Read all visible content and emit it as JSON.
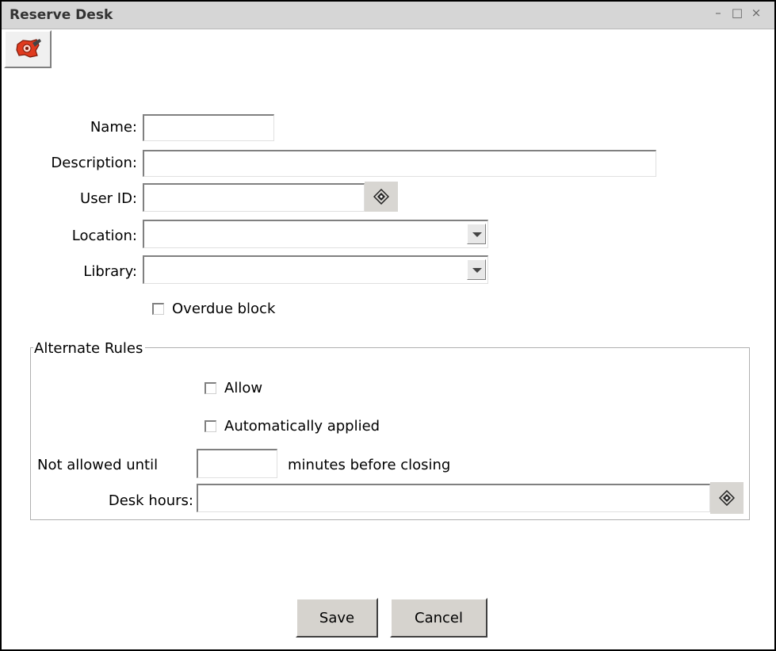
{
  "window": {
    "title": "Reserve Desk",
    "controls": {
      "minimize": "–",
      "maximize": "□",
      "close": "×"
    }
  },
  "toolbar": {
    "icon": "map-pin-icon"
  },
  "form": {
    "name": {
      "label": "Name:",
      "value": ""
    },
    "description": {
      "label": "Description:",
      "value": ""
    },
    "user_id": {
      "label": "User ID:",
      "value": "",
      "lookup_icon": "lookup-icon"
    },
    "location": {
      "label": "Location:",
      "selected": ""
    },
    "library": {
      "label": "Library:",
      "selected": ""
    },
    "overdue_block": {
      "label": "Overdue block",
      "checked": false
    }
  },
  "alternate_rules": {
    "legend": "Alternate Rules",
    "allow": {
      "label": "Allow",
      "checked": false
    },
    "automatically_applied": {
      "label": "Automatically applied",
      "checked": false
    },
    "not_allowed_until": {
      "label": "Not allowed until",
      "value": "",
      "suffix": "minutes before closing"
    },
    "desk_hours": {
      "label": "Desk hours:",
      "value": "",
      "lookup_icon": "lookup-icon"
    }
  },
  "buttons": {
    "save": "Save",
    "cancel": "Cancel"
  },
  "colors": {
    "titlebar": "#d6d6d6",
    "button_face": "#d6d3ce",
    "icon_red": "#e03a1e"
  }
}
